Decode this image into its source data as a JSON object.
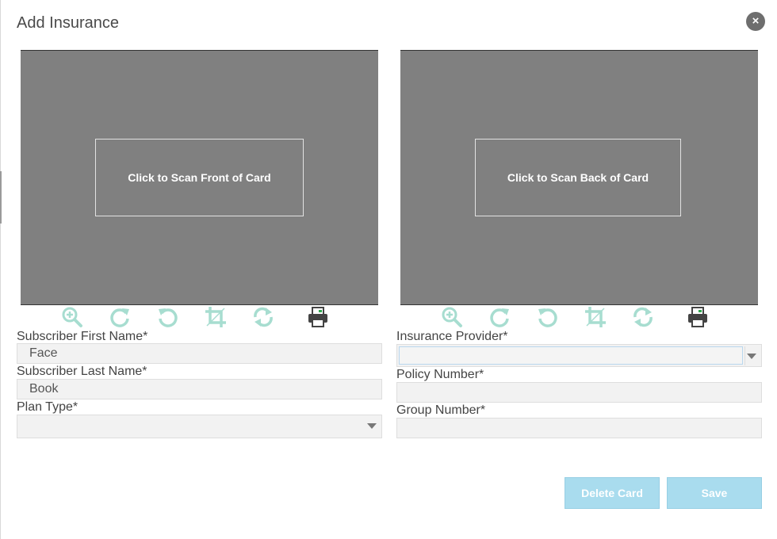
{
  "modal": {
    "title": "Add Insurance",
    "close_label": "×"
  },
  "scan": {
    "front_label": "Click to Scan Front of Card",
    "back_label": "Click to Scan Back of Card"
  },
  "toolbar_icons": [
    "zoom-in-icon",
    "rotate-clockwise-icon",
    "rotate-counterclockwise-icon",
    "crop-icon",
    "flip-icon",
    "print-icon"
  ],
  "form": {
    "first_name": {
      "label": "Subscriber First Name*",
      "value": "Face"
    },
    "last_name": {
      "label": "Subscriber Last Name*",
      "value": "Book"
    },
    "plan_type": {
      "label": "Plan Type*",
      "value": ""
    },
    "provider": {
      "label": "Insurance Provider*",
      "value": ""
    },
    "policy_number": {
      "label": "Policy Number*",
      "value": ""
    },
    "group_number": {
      "label": "Group Number*",
      "value": ""
    }
  },
  "buttons": {
    "delete_label": "Delete Card",
    "save_label": "Save"
  },
  "colors": {
    "accent": "#a9dcee",
    "icon": "#a7ddd0",
    "scan_bg": "#808080"
  }
}
